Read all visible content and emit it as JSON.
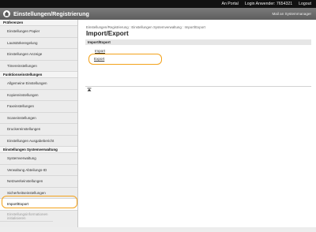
{
  "topbar": {
    "portal_link": "An Portal",
    "login_user": "Login Anwender: 7654321",
    "logout": "Logout"
  },
  "titlebar": {
    "title": "Einstellungen/Registrierung",
    "portal_mail": "Mail an Systemmanager"
  },
  "sidebar": {
    "sections": [
      {
        "header": "Präferenzen",
        "items": [
          "Einstellungen Papier",
          "Lautstärkeregelung",
          "Einstellungen Anzeige",
          "Timereinstellungen"
        ]
      },
      {
        "header": "Funktionseinstellungen",
        "items": [
          "Allgemeine Einstellungen",
          "Kopiereinstellungen",
          "Faxeinstellungen",
          "Scaneinstellungen",
          "Druckereinstellungen",
          "Einstellungen Ausgabebericht"
        ]
      },
      {
        "header": "Einstellungen Systemverwaltung",
        "items": [
          "Systemverwaltung",
          "Verwaltung Abteilungs-ID",
          "Netzwerkeinstellungen",
          "Sicherheitseinstellungen",
          "Import/Export"
        ],
        "disabled_item": "Einstellungsinformationen initialisieren"
      }
    ],
    "active_item": "Import/Export"
  },
  "main": {
    "breadcrumb": "Einstellungen/Registrierung : Einstellungen Systemverwaltung : Import/Export",
    "page_title": "Import/Export",
    "panel_header": "Import/Export",
    "links": [
      "Import",
      "Export"
    ]
  },
  "colors": {
    "highlight": "#f3a21b",
    "titlebar": "#666666",
    "topbar": "#111111"
  },
  "icons": {
    "home": "home-icon",
    "to_top": "arrow-up-icon"
  }
}
